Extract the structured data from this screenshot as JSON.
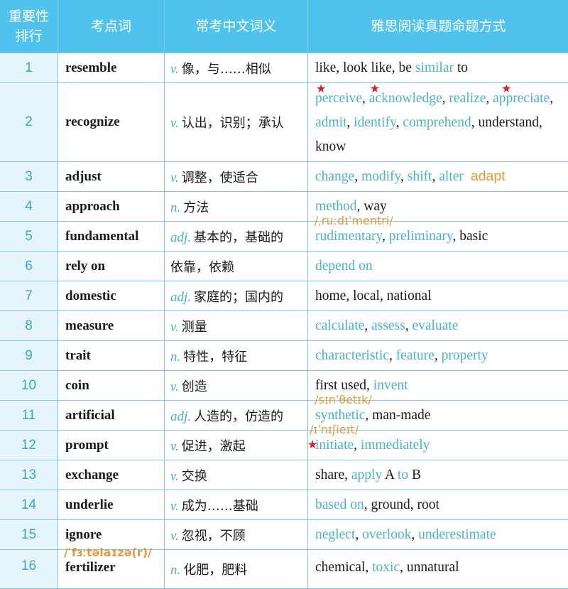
{
  "header": {
    "rank_line1": "重要性",
    "rank_line2": "排行",
    "word": "考点词",
    "meaning": "常考中文词义",
    "paraphrase": "雅思阅读真题命题方式"
  },
  "colors": {
    "header_bg": "#4fc2ee",
    "rank_bg": "#e6f5fb",
    "teal_text": "#4bb2c4",
    "orange_note": "#e29a3c",
    "star_red": "#d81f26"
  },
  "rows": [
    {
      "rank": "1",
      "word": "resemble",
      "pos": "v.",
      "cn": "像，与……相似",
      "ex": [
        [
          "like, look like, be ",
          "k"
        ],
        [
          "similar",
          "t"
        ],
        [
          " to",
          "k"
        ]
      ]
    },
    {
      "rank": "2",
      "word": "recognize",
      "pos": "v.",
      "cn": "认出，识别；承认",
      "ex": [
        [
          "perceive",
          "t"
        ],
        [
          ", ",
          "k"
        ],
        [
          "acknowledge",
          "t"
        ],
        [
          ", ",
          "k"
        ],
        [
          "realize",
          "t"
        ],
        [
          ", ",
          "k"
        ],
        [
          "appreciate",
          "t"
        ],
        [
          ", ",
          "k"
        ],
        [
          "admit",
          "t"
        ],
        [
          ", ",
          "k"
        ],
        [
          "identify",
          "t"
        ],
        [
          ", ",
          "k"
        ],
        [
          "comprehend",
          "t"
        ],
        [
          ", understand, know",
          "k"
        ]
      ],
      "starred": [
        "perceive",
        "acknowledge",
        "appreciate"
      ]
    },
    {
      "rank": "3",
      "word": "adjust",
      "pos": "v.",
      "cn": "调整，使适合",
      "ex": [
        [
          "change",
          "t"
        ],
        [
          ", ",
          "k"
        ],
        [
          "modify",
          "t"
        ],
        [
          ", ",
          "k"
        ],
        [
          "shift",
          "t"
        ],
        [
          ", ",
          "k"
        ],
        [
          "alter",
          "t"
        ]
      ],
      "note": "adapt"
    },
    {
      "rank": "4",
      "word": "approach",
      "pos": "n.",
      "cn": "方法",
      "ex": [
        [
          "method",
          "t"
        ],
        [
          ", way",
          "k"
        ]
      ]
    },
    {
      "rank": "5",
      "word": "fundamental",
      "pos": "adj.",
      "cn": "基本的，基础的",
      "ex": [
        [
          "rudimentary",
          "t"
        ],
        [
          ", ",
          "k"
        ],
        [
          "preliminary",
          "t"
        ],
        [
          ", basic",
          "k"
        ]
      ],
      "phonetic": "/ˌruːdɪˈmentri/"
    },
    {
      "rank": "6",
      "word": "rely on",
      "pos": "",
      "cn": "依靠，依赖",
      "ex": [
        [
          "depend on",
          "t"
        ]
      ]
    },
    {
      "rank": "7",
      "word": "domestic",
      "pos": "adj.",
      "cn": "家庭的；国内的",
      "ex": [
        [
          "home, local, national",
          "k"
        ]
      ]
    },
    {
      "rank": "8",
      "word": "measure",
      "pos": "v.",
      "cn": "测量",
      "ex": [
        [
          "calculate",
          "t"
        ],
        [
          ", ",
          "k"
        ],
        [
          "assess",
          "t"
        ],
        [
          ", ",
          "k"
        ],
        [
          "evaluate",
          "t"
        ]
      ]
    },
    {
      "rank": "9",
      "word": "trait",
      "pos": "n.",
      "cn": "特性，特征",
      "ex": [
        [
          "characteristic",
          "t"
        ],
        [
          ", ",
          "k"
        ],
        [
          "feature",
          "t"
        ],
        [
          ", ",
          "k"
        ],
        [
          "property",
          "t"
        ]
      ]
    },
    {
      "rank": "10",
      "word": "coin",
      "pos": "v.",
      "cn": "创造",
      "ex": [
        [
          "first used, ",
          "k"
        ],
        [
          "invent",
          "t"
        ]
      ]
    },
    {
      "rank": "11",
      "word": "artificial",
      "pos": "adj.",
      "cn": "人造的，仿造的",
      "ex": [
        [
          "synthetic",
          "t"
        ],
        [
          ", man-made",
          "k"
        ]
      ],
      "phonetic": "/sɪnˈθetɪk/"
    },
    {
      "rank": "12",
      "word": "prompt",
      "pos": "v.",
      "cn": "促进，激起",
      "ex": [
        [
          "initiate",
          "t"
        ],
        [
          ", ",
          "k"
        ],
        [
          "immediately",
          "t"
        ]
      ],
      "phonetic": "/ɪˈnɪʃieɪt/",
      "starred": [
        "initiate"
      ]
    },
    {
      "rank": "13",
      "word": "exchange",
      "pos": "v.",
      "cn": "交换",
      "ex": [
        [
          "share, ",
          "k"
        ],
        [
          "apply",
          "t"
        ],
        [
          " A ",
          "k"
        ],
        [
          "to",
          "t"
        ],
        [
          " B",
          "k"
        ]
      ]
    },
    {
      "rank": "14",
      "word": "underlie",
      "pos": "v.",
      "cn": "成为……基础",
      "ex": [
        [
          "based on",
          "t"
        ],
        [
          ", ground, root",
          "k"
        ]
      ]
    },
    {
      "rank": "15",
      "word": "ignore",
      "pos": "v.",
      "cn": "忽视，不顾",
      "ex": [
        [
          "neglect",
          "t"
        ],
        [
          ", ",
          "k"
        ],
        [
          "overlook",
          "t"
        ],
        [
          ", ",
          "k"
        ],
        [
          "underestimate",
          "t"
        ]
      ]
    },
    {
      "rank": "16",
      "word": "fertilizer",
      "pos": "n.",
      "cn": "化肥，肥料",
      "ex": [
        [
          "chemical, ",
          "k"
        ],
        [
          "toxic",
          "t"
        ],
        [
          ", unnatural",
          "k"
        ]
      ],
      "word_phonetic": "/ˈfɜːtəlaɪzə(r)/"
    }
  ]
}
